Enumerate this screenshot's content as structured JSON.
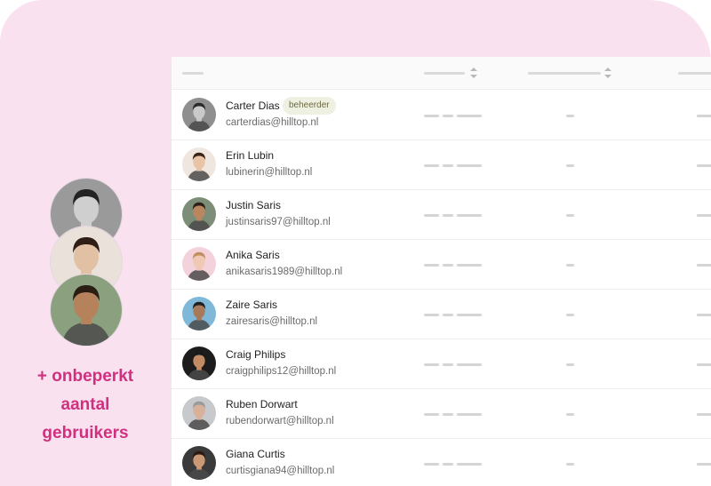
{
  "promo": {
    "line1": "+ onbeperkt",
    "line2": "aantal",
    "line3": "gebruikers"
  },
  "users": [
    {
      "name": "Carter Dias",
      "email": "carterdias@hilltop.nl",
      "badge": "beheerder",
      "skin": "#c9c9c9",
      "hair": "#2a2a2a",
      "bg": "#8f8f8f"
    },
    {
      "name": "Erin Lubin",
      "email": "lubinerin@hilltop.nl",
      "skin": "#e8c3a6",
      "hair": "#3a2418",
      "bg": "#efe6df"
    },
    {
      "name": "Justin Saris",
      "email": "justinsaris97@hilltop.nl",
      "skin": "#b98660",
      "hair": "#2c2017",
      "bg": "#7c8e77"
    },
    {
      "name": "Anika Saris",
      "email": "anikasaris1989@hilltop.nl",
      "skin": "#efc9b5",
      "hair": "#c2905d",
      "bg": "#f3d2dc"
    },
    {
      "name": "Zaire Saris",
      "email": "zairesaris@hilltop.nl",
      "skin": "#a87a5a",
      "hair": "#1f1f1f",
      "bg": "#7fb8d8"
    },
    {
      "name": "Craig Philips",
      "email": "craigphilips12@hilltop.nl",
      "skin": "#c28b63",
      "hair": "#1a1a1a",
      "bg": "#1c1c1c"
    },
    {
      "name": "Ruben Dorwart",
      "email": "rubendorwart@hilltop.nl",
      "skin": "#d7b19a",
      "hair": "#9a9a9a",
      "bg": "#c7c9cc"
    },
    {
      "name": "Giana Curtis",
      "email": "curtisgiana94@hilltop.nl",
      "skin": "#c99874",
      "hair": "#2a1a12",
      "bg": "#3a3a3a"
    }
  ],
  "stack": [
    {
      "skin": "#cfcfcf",
      "hair": "#232323",
      "bg": "#9a9a9a"
    },
    {
      "skin": "#e2c0a4",
      "hair": "#2e1e16",
      "bg": "#e9e1da"
    },
    {
      "skin": "#b5825c",
      "hair": "#2a1d14",
      "bg": "#8aa07f"
    }
  ]
}
